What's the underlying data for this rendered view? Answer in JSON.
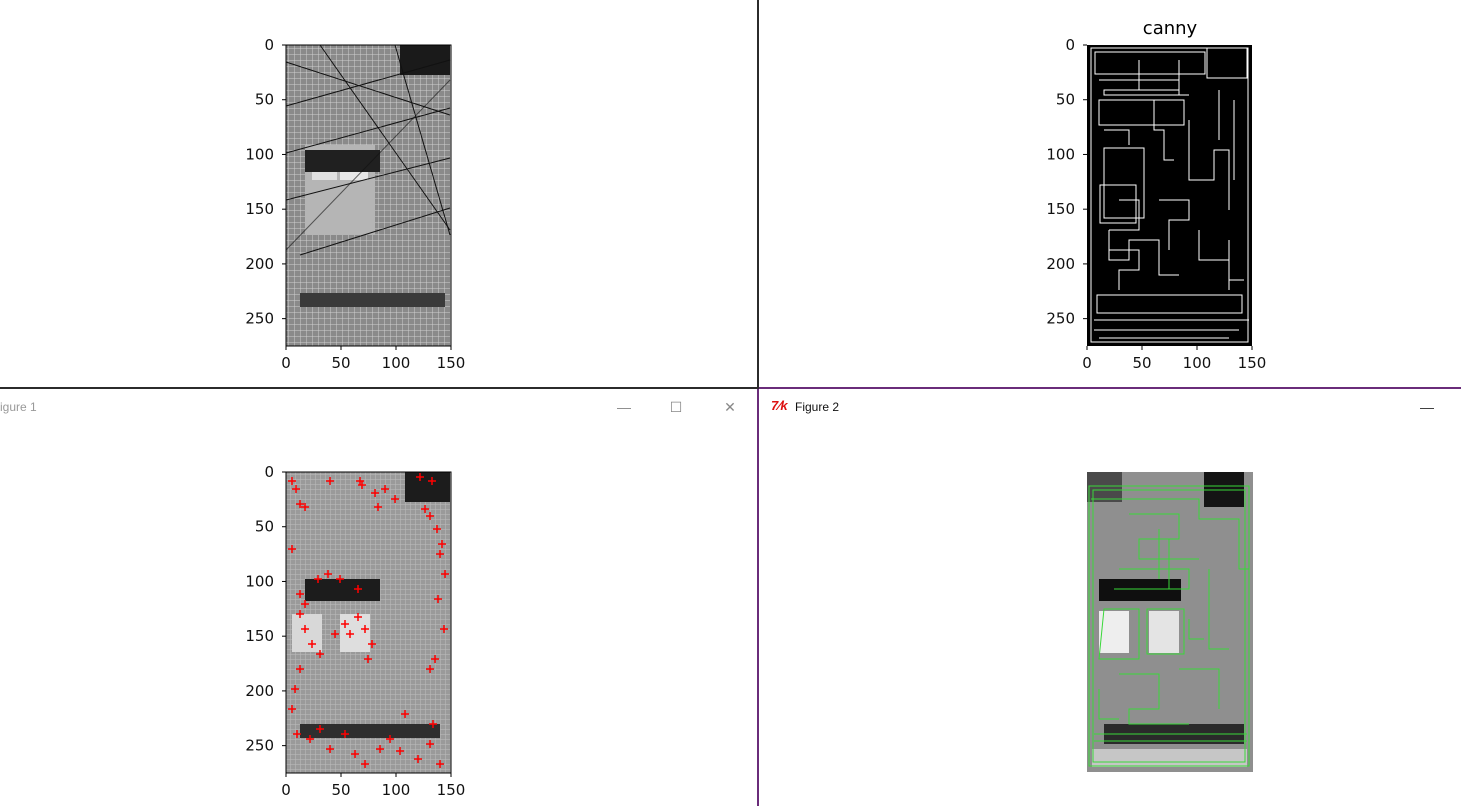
{
  "figure1": {
    "title": "igure 1",
    "buttons": {
      "minimize": "—",
      "maximize": "☐",
      "close": "✕"
    }
  },
  "figure2": {
    "title": "Figure 2",
    "app_icon": "tk-feather-icon",
    "buttons": {
      "minimize": "—"
    }
  },
  "plots": {
    "top_left": {
      "title": "",
      "x_ticks": [
        "0",
        "50",
        "100",
        "150"
      ],
      "y_ticks": [
        "0",
        "50",
        "100",
        "150",
        "200",
        "250"
      ]
    },
    "top_right": {
      "title": "canny",
      "x_ticks": [
        "0",
        "50",
        "100",
        "150"
      ],
      "y_ticks": [
        "0",
        "50",
        "100",
        "150",
        "200",
        "250"
      ]
    },
    "bottom_left": {
      "title": "",
      "x_ticks": [
        "0",
        "50",
        "100",
        "150"
      ],
      "y_ticks": [
        "0",
        "50",
        "100",
        "150",
        "200",
        "250"
      ]
    },
    "bottom_right": {
      "title": ""
    }
  },
  "colors": {
    "marker": "#ff0000",
    "contour": "#39d839",
    "divider": "#2b2b2b",
    "active_border": "#6a2c7a"
  }
}
